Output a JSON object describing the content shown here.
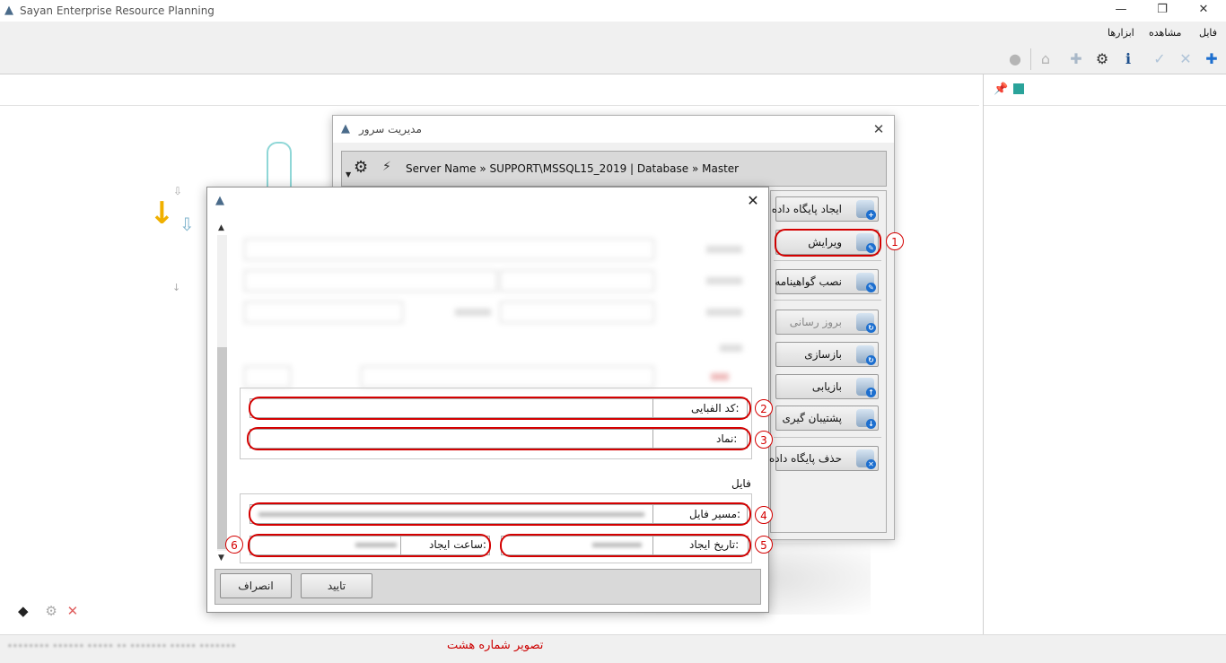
{
  "app": {
    "title": "Sayan Enterprise Resource Planning"
  },
  "window_controls": {
    "minimize": "—",
    "maximize": "❐",
    "close": "✕"
  },
  "menu": {
    "items": [
      "فایل",
      "مشاهده",
      "ابزارها"
    ]
  },
  "server_window": {
    "title": "مدیریت سرور",
    "close": "✕",
    "info": "Server Name » SUPPORT\\MSSQL15_2019 | Database » Master",
    "buttons": [
      {
        "label": "ایجاد پایگاه داده",
        "badge": "+"
      },
      {
        "label": "ویرایش",
        "badge": "✎"
      },
      {
        "label": "نصب گواهینامه",
        "badge": "✎"
      },
      {
        "label": "بروز رسانی",
        "badge": "↻"
      },
      {
        "label": "بازسازی",
        "badge": "↻"
      },
      {
        "label": "بازیابی",
        "badge": "↑"
      },
      {
        "label": "پشتیبان گیری",
        "badge": "↓"
      },
      {
        "label": "حذف پایگاه داده",
        "badge": "✕"
      }
    ]
  },
  "edit_dialog": {
    "close": "✕",
    "fields": {
      "alphabet_code_label": "کد الفبایی:",
      "symbol_label": "نماد:",
      "file_group_label": "فایل",
      "file_path_label": "مسیر فایل:",
      "created_date_label": "تاریخ ایجاد:",
      "created_time_label": "ساعت ایجاد:"
    },
    "buttons": {
      "confirm": "تایید",
      "cancel": "انصراف"
    }
  },
  "callouts": [
    "1",
    "2",
    "3",
    "4",
    "5",
    "6"
  ],
  "caption": "تصویر شماره هشت",
  "colors": {
    "callout_red": "#d40000",
    "accent_yellow": "#f0b000",
    "toolbar_bg": "#f0f0f0"
  }
}
